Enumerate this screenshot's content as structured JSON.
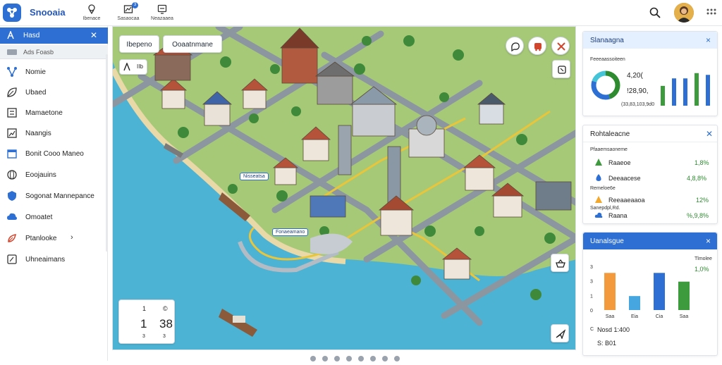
{
  "app": {
    "title": "Snooaia",
    "colors": {
      "accent": "#2d6fd2",
      "water": "#4db3d4",
      "grass": "#9cc56a",
      "road": "#8c96a0",
      "route": "#e8c53a"
    }
  },
  "toolbar": [
    {
      "icon": "pin-icon",
      "label": "Ibenace"
    },
    {
      "icon": "map-icon",
      "label": "Sasaocaa",
      "badge": "3"
    },
    {
      "icon": "screen-icon",
      "label": "Neazaaea"
    }
  ],
  "sidebar": {
    "header": "Hasd",
    "sub": "Ads Foasb",
    "items": [
      {
        "icon": "nodes-icon",
        "label": "Nomie"
      },
      {
        "icon": "leaf-icon",
        "label": "Ubaed"
      },
      {
        "icon": "list-icon",
        "label": "Mamaetone"
      },
      {
        "icon": "chart-icon",
        "label": "Naangis"
      },
      {
        "icon": "calendar-icon",
        "label": "Bonit Cooo Maneo"
      },
      {
        "icon": "globe-icon",
        "label": "Eoojauins"
      },
      {
        "icon": "shield-icon",
        "label": "Sogonat Mannepance"
      },
      {
        "icon": "cloud-icon",
        "label": "Omoatet"
      },
      {
        "icon": "rocket-icon",
        "label": "Ptanlooke",
        "chevron": "›"
      },
      {
        "icon": "doc-icon",
        "label": "Uhneaimans"
      }
    ]
  },
  "map": {
    "tabs": [
      "Ibepeno",
      "Ooaatnmane"
    ],
    "chip_label": "IIb",
    "labels": [
      "Nisseatsa",
      "Fonaeamano"
    ],
    "stat": {
      "top_left": "1",
      "top_right": "©",
      "mid_left": "1",
      "mid_right": "38",
      "bottom_left": "3",
      "bottom_right": "3"
    },
    "pager_count": 8
  },
  "panel1": {
    "title": "Slanaagna",
    "close": "×",
    "subtitle": "Feeeaassoiteen",
    "value1": "4,20(",
    "value2": "!28,90,",
    "caption": "(33,83,103,9d0",
    "donut": [
      {
        "value": 45,
        "color": "#2e8b30"
      },
      {
        "value": 35,
        "color": "#2d6fd2"
      },
      {
        "value": 20,
        "color": "#45c4d8"
      }
    ],
    "bars": [
      {
        "value": 45,
        "color": "#3d9a3d"
      },
      {
        "value": 62,
        "color": "#2d6fd2"
      },
      {
        "value": 62,
        "color": "#2d6fd2"
      },
      {
        "value": 74,
        "color": "#3d9a3d"
      },
      {
        "value": 70,
        "color": "#2d6fd2"
      }
    ]
  },
  "panel2": {
    "title": "Rohtaleacne",
    "close": "✕",
    "caption": "Pfaaemsaoneme",
    "rows": [
      {
        "icon": "leaf-icon",
        "label": "Raaeoe",
        "value": "1,8%",
        "color": "#2e8b30"
      },
      {
        "icon": "drop-icon",
        "label": "Deeaacese",
        "value": "4,8,8%",
        "color": "#2e8b30"
      },
      {
        "icon": "warning-icon",
        "label": "Reeaaeaaoa",
        "value": "12%",
        "color": "#2e8b30"
      },
      {
        "icon": "cloud-icon",
        "label": "Raana",
        "value": "%,9,8%",
        "color": "#2e8b30"
      }
    ],
    "subcaptions": [
      "Remeloe6e",
      "Sanepdpl,Rd."
    ]
  },
  "panel3": {
    "title": "Uanalsgue",
    "close": "×",
    "top_right_small": "Tlmolee",
    "top_right_value": "1,0%",
    "y_ticks": [
      "3",
      "3",
      "1",
      "0"
    ],
    "bars": [
      {
        "label": "Saa",
        "value": 85,
        "color": "#f39a3c"
      },
      {
        "label": "Eia",
        "value": 32,
        "color": "#45a6e0"
      },
      {
        "label": "Cia",
        "value": 85,
        "color": "#2d6fd2"
      },
      {
        "label": "Saa",
        "value": 65,
        "color": "#3d9a3d"
      }
    ],
    "ylim": [
      0,
      100
    ],
    "footer_icon_text": "C",
    "footer_main": "Nosd 1:400",
    "footer_sub": "S: B01"
  }
}
